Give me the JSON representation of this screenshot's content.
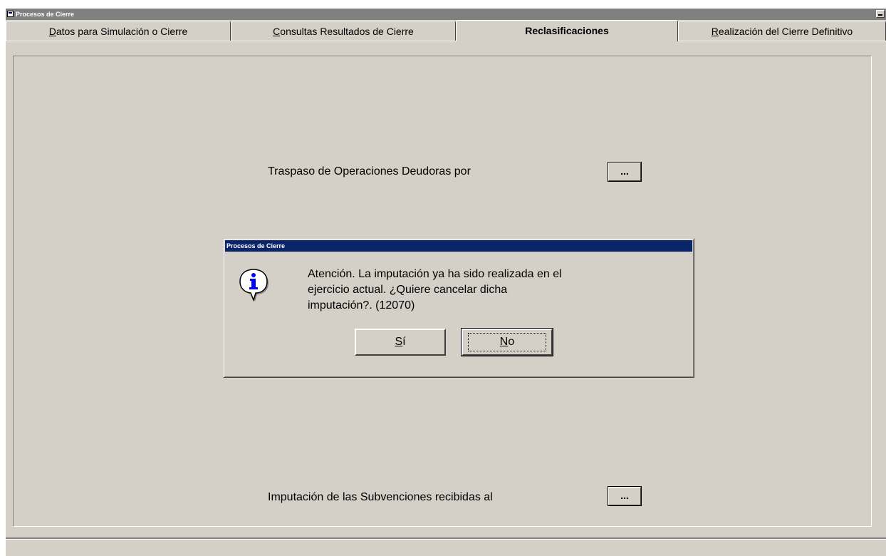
{
  "window": {
    "title": "Procesos de Cierre"
  },
  "tabs": [
    {
      "label_pre": "",
      "label_u": "D",
      "label_post": "atos para Simulación o Cierre",
      "active": false
    },
    {
      "label_pre": "",
      "label_u": "C",
      "label_post": "onsultas Resultados de Cierre",
      "active": false
    },
    {
      "label_pre": "Reclasificaciones",
      "label_u": "",
      "label_post": "",
      "active": true
    },
    {
      "label_pre": "",
      "label_u": "R",
      "label_post": "ealización del Cierre Definitivo",
      "active": false
    }
  ],
  "panel": {
    "row1_label": "Traspaso de Operaciones Deudoras por",
    "row1_button": "...",
    "row2_label": "Imputación de las Subvenciones recibidas al",
    "row2_button": "..."
  },
  "dialog": {
    "title": "Procesos de Cierre",
    "icon": "info-icon",
    "message_line1": "Atención. La imputación ya ha sido realizada en el",
    "message_line2": "ejercicio actual. ¿Quiere cancelar dicha",
    "message_line3": "imputación?. (12070)",
    "yes_u": "S",
    "yes_rest": "í",
    "no_u": "N",
    "no_rest": "o"
  }
}
